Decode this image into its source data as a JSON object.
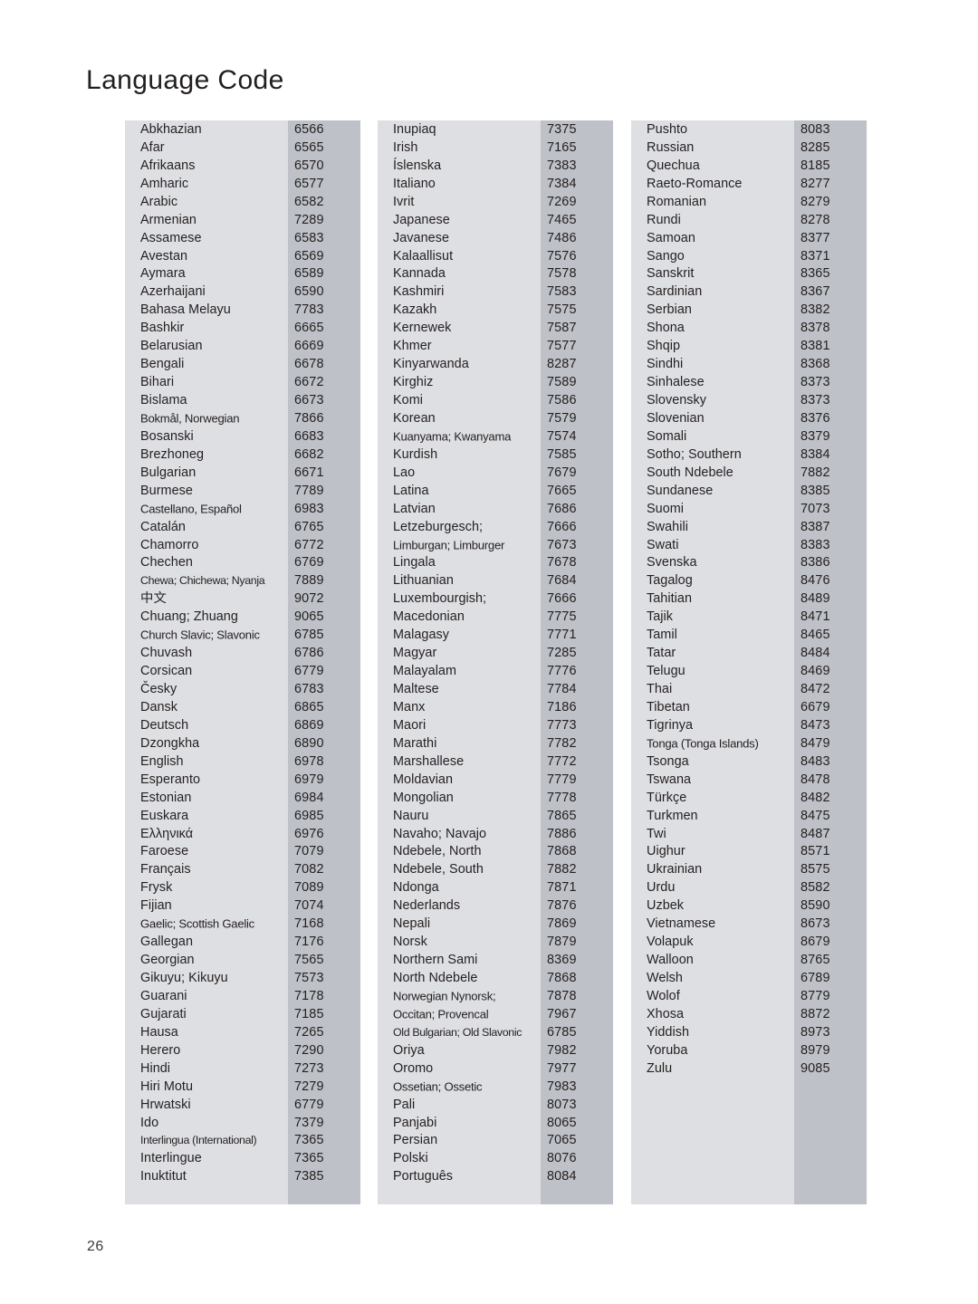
{
  "page": {
    "title": "Language Code",
    "page_number": "26",
    "colors": {
      "background": "#ffffff",
      "block_background": "#dedfe2",
      "code_band": "#bec1c7",
      "text": "#231f20"
    }
  },
  "columns": [
    {
      "id": "column-1",
      "rows": [
        {
          "language": "Abkhazian",
          "code": "6566"
        },
        {
          "language": "Afar",
          "code": "6565"
        },
        {
          "language": "Afrikaans",
          "code": "6570"
        },
        {
          "language": "Amharic",
          "code": "6577"
        },
        {
          "language": "Arabic",
          "code": "6582"
        },
        {
          "language": "Armenian",
          "code": "7289"
        },
        {
          "language": "Assamese",
          "code": "6583"
        },
        {
          "language": "Avestan",
          "code": "6569"
        },
        {
          "language": "Aymara",
          "code": "6589"
        },
        {
          "language": "Azerhaijani",
          "code": "6590"
        },
        {
          "language": "Bahasa Melayu",
          "code": "7783"
        },
        {
          "language": "Bashkir",
          "code": "6665"
        },
        {
          "language": "Belarusian",
          "code": "6669"
        },
        {
          "language": "Bengali",
          "code": "6678"
        },
        {
          "language": "Bihari",
          "code": "6672"
        },
        {
          "language": "Bislama",
          "code": "6673"
        },
        {
          "language": "Bokmål, Norwegian",
          "code": "7866",
          "fit": "squeeze"
        },
        {
          "language": "Bosanski",
          "code": "6683"
        },
        {
          "language": "Brezhoneg",
          "code": "6682"
        },
        {
          "language": "Bulgarian",
          "code": "6671"
        },
        {
          "language": "Burmese",
          "code": "7789"
        },
        {
          "language": "Castellano, Español",
          "code": "6983",
          "fit": "squeeze"
        },
        {
          "language": "Catalán",
          "code": "6765"
        },
        {
          "language": "Chamorro",
          "code": "6772"
        },
        {
          "language": "Chechen",
          "code": "6769"
        },
        {
          "language": "Chewa; Chichewa; Nyanja",
          "code": "7889",
          "fit": "squeeze2"
        },
        {
          "language": "中文",
          "code": "9072"
        },
        {
          "language": "Chuang; Zhuang",
          "code": "9065"
        },
        {
          "language": "Church Slavic; Slavonic",
          "code": "6785",
          "fit": "squeeze"
        },
        {
          "language": "Chuvash",
          "code": "6786"
        },
        {
          "language": "Corsican",
          "code": "6779"
        },
        {
          "language": "Česky",
          "code": "6783"
        },
        {
          "language": "Dansk",
          "code": "6865"
        },
        {
          "language": "Deutsch",
          "code": "6869"
        },
        {
          "language": "Dzongkha",
          "code": "6890"
        },
        {
          "language": "English",
          "code": "6978"
        },
        {
          "language": "Esperanto",
          "code": "6979"
        },
        {
          "language": "Estonian",
          "code": "6984"
        },
        {
          "language": "Euskara",
          "code": "6985"
        },
        {
          "language": "Ελληνικά",
          "code": "6976"
        },
        {
          "language": "Faroese",
          "code": "7079"
        },
        {
          "language": "Français",
          "code": "7082"
        },
        {
          "language": "Frysk",
          "code": "7089"
        },
        {
          "language": "Fijian",
          "code": "7074"
        },
        {
          "language": "Gaelic; Scottish Gaelic",
          "code": "7168",
          "fit": "squeeze"
        },
        {
          "language": "Gallegan",
          "code": "7176"
        },
        {
          "language": "Georgian",
          "code": "7565"
        },
        {
          "language": "Gikuyu; Kikuyu",
          "code": "7573"
        },
        {
          "language": "Guarani",
          "code": "7178"
        },
        {
          "language": "Gujarati",
          "code": "7185"
        },
        {
          "language": "Hausa",
          "code": "7265"
        },
        {
          "language": "Herero",
          "code": "7290"
        },
        {
          "language": "Hindi",
          "code": "7273"
        },
        {
          "language": "Hiri Motu",
          "code": "7279"
        },
        {
          "language": "Hrwatski",
          "code": "6779"
        },
        {
          "language": "Ido",
          "code": "7379"
        },
        {
          "language": "Interlingua (International)",
          "code": "7365",
          "fit": "squeeze2"
        },
        {
          "language": "Interlingue",
          "code": "7365"
        },
        {
          "language": "Inuktitut",
          "code": "7385"
        }
      ]
    },
    {
      "id": "column-2",
      "rows": [
        {
          "language": "Inupiaq",
          "code": "7375"
        },
        {
          "language": "Irish",
          "code": "7165"
        },
        {
          "language": "Íslenska",
          "code": "7383"
        },
        {
          "language": "Italiano",
          "code": "7384"
        },
        {
          "language": "Ivrit",
          "code": "7269"
        },
        {
          "language": "Japanese",
          "code": "7465"
        },
        {
          "language": "Javanese",
          "code": "7486"
        },
        {
          "language": "Kalaallisut",
          "code": "7576"
        },
        {
          "language": "Kannada",
          "code": "7578"
        },
        {
          "language": "Kashmiri",
          "code": "7583"
        },
        {
          "language": "Kazakh",
          "code": "7575"
        },
        {
          "language": "Kernewek",
          "code": "7587"
        },
        {
          "language": "Khmer",
          "code": "7577"
        },
        {
          "language": "Kinyarwanda",
          "code": "8287"
        },
        {
          "language": "Kirghiz",
          "code": "7589"
        },
        {
          "language": "Komi",
          "code": "7586"
        },
        {
          "language": "Korean",
          "code": "7579"
        },
        {
          "language": "Kuanyama; Kwanyama",
          "code": "7574",
          "fit": "squeeze"
        },
        {
          "language": "Kurdish",
          "code": "7585"
        },
        {
          "language": "Lao",
          "code": "7679"
        },
        {
          "language": "Latina",
          "code": "7665"
        },
        {
          "language": "Latvian",
          "code": "7686"
        },
        {
          "language": "Letzeburgesch;",
          "code": "7666"
        },
        {
          "language": "Limburgan; Limburger",
          "code": "7673",
          "fit": "squeeze"
        },
        {
          "language": "Lingala",
          "code": "7678"
        },
        {
          "language": "Lithuanian",
          "code": "7684"
        },
        {
          "language": "Luxembourgish;",
          "code": "7666"
        },
        {
          "language": "Macedonian",
          "code": "7775"
        },
        {
          "language": "Malagasy",
          "code": "7771"
        },
        {
          "language": "Magyar",
          "code": "7285"
        },
        {
          "language": "Malayalam",
          "code": "7776"
        },
        {
          "language": "Maltese",
          "code": "7784"
        },
        {
          "language": "Manx",
          "code": "7186"
        },
        {
          "language": "Maori",
          "code": "7773"
        },
        {
          "language": "Marathi",
          "code": "7782"
        },
        {
          "language": "Marshallese",
          "code": "7772"
        },
        {
          "language": "Moldavian",
          "code": "7779"
        },
        {
          "language": "Mongolian",
          "code": "7778"
        },
        {
          "language": "Nauru",
          "code": "7865"
        },
        {
          "language": "Navaho; Navajo",
          "code": "7886"
        },
        {
          "language": "Ndebele, North",
          "code": "7868"
        },
        {
          "language": "Ndebele, South",
          "code": "7882"
        },
        {
          "language": "Ndonga",
          "code": "7871"
        },
        {
          "language": "Nederlands",
          "code": "7876"
        },
        {
          "language": "Nepali",
          "code": "7869"
        },
        {
          "language": "Norsk",
          "code": "7879"
        },
        {
          "language": "Northern Sami",
          "code": "8369"
        },
        {
          "language": "North Ndebele",
          "code": "7868"
        },
        {
          "language": "Norwegian Nynorsk;",
          "code": "7878",
          "fit": "squeeze"
        },
        {
          "language": "Occitan; Provencal",
          "code": "7967",
          "fit": "squeeze"
        },
        {
          "language": "Old Bulgarian; Old Slavonic",
          "code": "6785",
          "fit": "squeeze2"
        },
        {
          "language": "Oriya",
          "code": "7982"
        },
        {
          "language": "Oromo",
          "code": "7977"
        },
        {
          "language": "Ossetian; Ossetic",
          "code": "7983",
          "fit": "squeeze"
        },
        {
          "language": "Pali",
          "code": "8073"
        },
        {
          "language": "Panjabi",
          "code": "8065"
        },
        {
          "language": "Persian",
          "code": "7065"
        },
        {
          "language": "Polski",
          "code": "8076"
        },
        {
          "language": "Português",
          "code": "8084"
        }
      ]
    },
    {
      "id": "column-3",
      "rows": [
        {
          "language": "Pushto",
          "code": "8083"
        },
        {
          "language": "Russian",
          "code": "8285"
        },
        {
          "language": "Quechua",
          "code": "8185"
        },
        {
          "language": "Raeto-Romance",
          "code": "8277"
        },
        {
          "language": "Romanian",
          "code": "8279"
        },
        {
          "language": "Rundi",
          "code": "8278"
        },
        {
          "language": "Samoan",
          "code": "8377"
        },
        {
          "language": "Sango",
          "code": "8371"
        },
        {
          "language": "Sanskrit",
          "code": "8365"
        },
        {
          "language": "Sardinian",
          "code": "8367"
        },
        {
          "language": "Serbian",
          "code": "8382"
        },
        {
          "language": "Shona",
          "code": "8378"
        },
        {
          "language": "Shqip",
          "code": "8381"
        },
        {
          "language": "Sindhi",
          "code": "8368"
        },
        {
          "language": "Sinhalese",
          "code": "8373"
        },
        {
          "language": "Slovensky",
          "code": "8373"
        },
        {
          "language": "Slovenian",
          "code": "8376"
        },
        {
          "language": "Somali",
          "code": "8379"
        },
        {
          "language": "Sotho; Southern",
          "code": "8384"
        },
        {
          "language": "South Ndebele",
          "code": "7882"
        },
        {
          "language": "Sundanese",
          "code": "8385"
        },
        {
          "language": "Suomi",
          "code": "7073"
        },
        {
          "language": "Swahili",
          "code": "8387"
        },
        {
          "language": "Swati",
          "code": "8383"
        },
        {
          "language": "Svenska",
          "code": "8386"
        },
        {
          "language": "Tagalog",
          "code": "8476"
        },
        {
          "language": "Tahitian",
          "code": "8489"
        },
        {
          "language": "Tajik",
          "code": "8471"
        },
        {
          "language": "Tamil",
          "code": "8465"
        },
        {
          "language": "Tatar",
          "code": "8484"
        },
        {
          "language": "Telugu",
          "code": "8469"
        },
        {
          "language": "Thai",
          "code": "8472"
        },
        {
          "language": "Tibetan",
          "code": "6679"
        },
        {
          "language": "Tigrinya",
          "code": "8473"
        },
        {
          "language": "Tonga (Tonga Islands)",
          "code": "8479",
          "fit": "squeeze"
        },
        {
          "language": "Tsonga",
          "code": "8483"
        },
        {
          "language": "Tswana",
          "code": "8478"
        },
        {
          "language": "Türkçe",
          "code": "8482"
        },
        {
          "language": "Turkmen",
          "code": "8475"
        },
        {
          "language": "Twi",
          "code": "8487"
        },
        {
          "language": "Uighur",
          "code": "8571"
        },
        {
          "language": "Ukrainian",
          "code": "8575"
        },
        {
          "language": "Urdu",
          "code": "8582"
        },
        {
          "language": "Uzbek",
          "code": "8590"
        },
        {
          "language": "Vietnamese",
          "code": "8673"
        },
        {
          "language": "Volapuk",
          "code": "8679"
        },
        {
          "language": "Walloon",
          "code": "8765"
        },
        {
          "language": "Welsh",
          "code": "6789"
        },
        {
          "language": "Wolof",
          "code": "8779"
        },
        {
          "language": "Xhosa",
          "code": "8872"
        },
        {
          "language": "Yiddish",
          "code": "8973"
        },
        {
          "language": "Yoruba",
          "code": "8979"
        },
        {
          "language": "Zulu",
          "code": "9085"
        }
      ]
    }
  ]
}
